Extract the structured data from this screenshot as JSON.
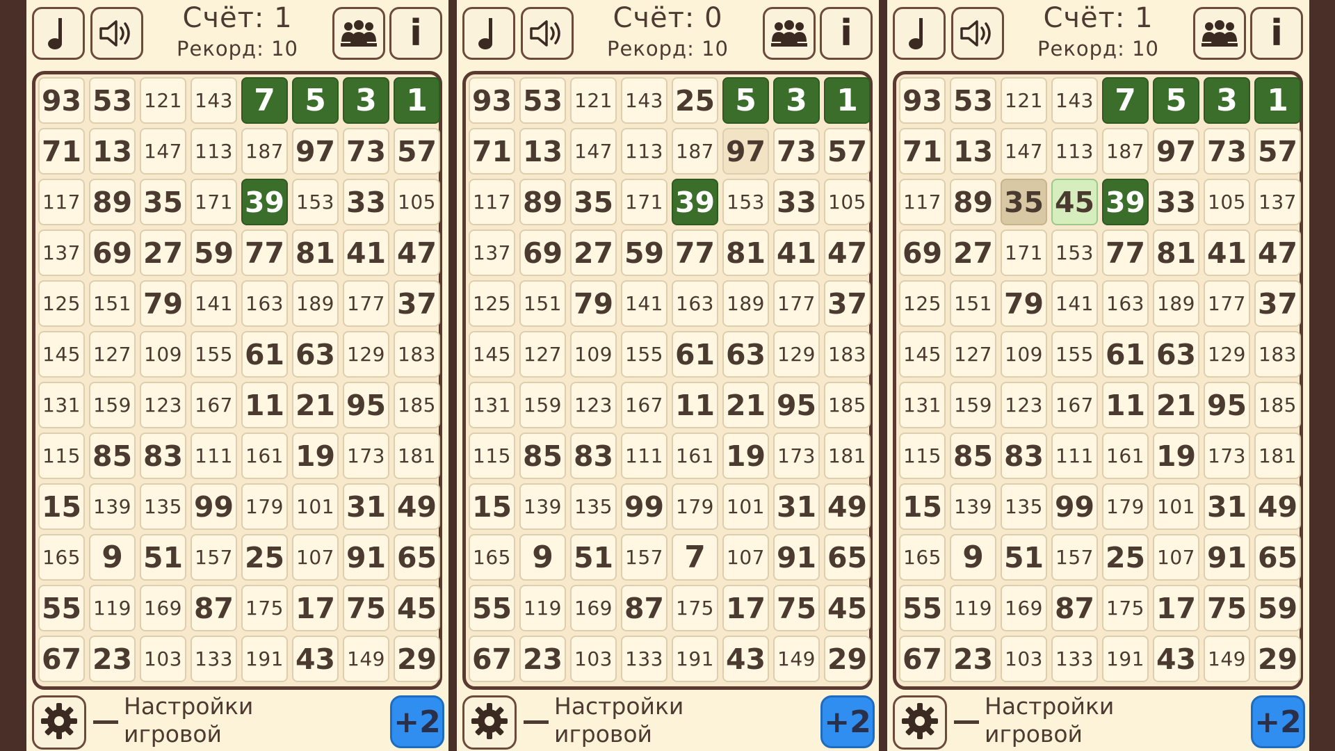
{
  "colors": {
    "background": "#4a2e28",
    "panel": "#fdf3d9",
    "cell": "#fff7e2",
    "cell_border": "#dccfae",
    "solved_green": "#3a6e2a",
    "highlight_light": "#d6edbe",
    "plus_button": "#2f8ef0",
    "text": "#4a3a30"
  },
  "icons": [
    "music-note-icon",
    "speaker-icon",
    "people-icon",
    "info-icon",
    "gear-icon"
  ],
  "labels": {
    "info_glyph": "i",
    "dash": "—",
    "settings_text": "Настройки игровой механики",
    "plus_label": "+2"
  },
  "screens": [
    {
      "score": "Счёт: 1",
      "record": "Рекорд: 10",
      "grid": [
        [
          "93",
          "53",
          "121",
          "143",
          "7",
          "5",
          "3",
          "1"
        ],
        [
          "71",
          "13",
          "147",
          "113",
          "187",
          "97",
          "73",
          "57"
        ],
        [
          "117",
          "89",
          "35",
          "171",
          "39",
          "153",
          "33",
          "105"
        ],
        [
          "137",
          "69",
          "27",
          "59",
          "77",
          "81",
          "41",
          "47"
        ],
        [
          "125",
          "151",
          "79",
          "141",
          "163",
          "189",
          "177",
          "37"
        ],
        [
          "145",
          "127",
          "109",
          "155",
          "61",
          "63",
          "129",
          "183"
        ],
        [
          "131",
          "159",
          "123",
          "167",
          "11",
          "21",
          "95",
          "185"
        ],
        [
          "115",
          "85",
          "83",
          "111",
          "161",
          "19",
          "173",
          "181"
        ],
        [
          "15",
          "139",
          "135",
          "99",
          "179",
          "101",
          "31",
          "49"
        ],
        [
          "165",
          "9",
          "51",
          "157",
          "25",
          "107",
          "91",
          "65"
        ],
        [
          "55",
          "119",
          "169",
          "87",
          "175",
          "17",
          "75",
          "45"
        ],
        [
          "67",
          "23",
          "103",
          "133",
          "191",
          "43",
          "149",
          "29"
        ]
      ],
      "states": [
        [
          "",
          "",
          "",
          "",
          "green",
          "green",
          "green",
          "green"
        ],
        [
          "",
          "",
          "",
          "",
          "",
          "",
          "",
          ""
        ],
        [
          "",
          "",
          "",
          "",
          "green",
          "",
          "",
          ""
        ],
        [
          "",
          "",
          "",
          "",
          "",
          "",
          "",
          ""
        ],
        [
          "",
          "",
          "",
          "",
          "",
          "",
          "",
          ""
        ],
        [
          "",
          "",
          "",
          "",
          "",
          "",
          "",
          ""
        ],
        [
          "",
          "",
          "",
          "",
          "",
          "",
          "",
          ""
        ],
        [
          "",
          "",
          "",
          "",
          "",
          "",
          "",
          ""
        ],
        [
          "",
          "",
          "",
          "",
          "",
          "",
          "",
          ""
        ],
        [
          "",
          "",
          "",
          "",
          "",
          "",
          "",
          ""
        ],
        [
          "",
          "",
          "",
          "",
          "",
          "",
          "",
          ""
        ],
        [
          "",
          "",
          "",
          "",
          "",
          "",
          "",
          ""
        ]
      ]
    },
    {
      "score": "Счёт: 0",
      "record": "Рекорд: 10",
      "grid": [
        [
          "93",
          "53",
          "121",
          "143",
          "25",
          "5",
          "3",
          "1"
        ],
        [
          "71",
          "13",
          "147",
          "113",
          "187",
          "97",
          "73",
          "57"
        ],
        [
          "117",
          "89",
          "35",
          "171",
          "39",
          "153",
          "33",
          "105"
        ],
        [
          "137",
          "69",
          "27",
          "59",
          "77",
          "81",
          "41",
          "47"
        ],
        [
          "125",
          "151",
          "79",
          "141",
          "163",
          "189",
          "177",
          "37"
        ],
        [
          "145",
          "127",
          "109",
          "155",
          "61",
          "63",
          "129",
          "183"
        ],
        [
          "131",
          "159",
          "123",
          "167",
          "11",
          "21",
          "95",
          "185"
        ],
        [
          "115",
          "85",
          "83",
          "111",
          "161",
          "19",
          "173",
          "181"
        ],
        [
          "15",
          "139",
          "135",
          "99",
          "179",
          "101",
          "31",
          "49"
        ],
        [
          "165",
          "9",
          "51",
          "157",
          "7",
          "107",
          "91",
          "65"
        ],
        [
          "55",
          "119",
          "169",
          "87",
          "175",
          "17",
          "75",
          "45"
        ],
        [
          "67",
          "23",
          "103",
          "133",
          "191",
          "43",
          "149",
          "29"
        ]
      ],
      "states": [
        [
          "",
          "",
          "",
          "",
          "",
          "green",
          "green",
          "green"
        ],
        [
          "",
          "",
          "",
          "",
          "",
          "sel",
          "",
          ""
        ],
        [
          "",
          "",
          "",
          "",
          "green",
          "",
          "",
          ""
        ],
        [
          "",
          "",
          "",
          "",
          "",
          "",
          "",
          ""
        ],
        [
          "",
          "",
          "",
          "",
          "",
          "",
          "",
          ""
        ],
        [
          "",
          "",
          "",
          "",
          "",
          "",
          "",
          ""
        ],
        [
          "",
          "",
          "",
          "",
          "",
          "",
          "",
          ""
        ],
        [
          "",
          "",
          "",
          "",
          "",
          "",
          "",
          ""
        ],
        [
          "",
          "",
          "",
          "",
          "",
          "",
          "",
          ""
        ],
        [
          "",
          "",
          "",
          "",
          "",
          "",
          "",
          ""
        ],
        [
          "",
          "",
          "",
          "",
          "",
          "",
          "",
          ""
        ],
        [
          "",
          "",
          "",
          "",
          "",
          "",
          "",
          ""
        ]
      ]
    },
    {
      "score": "Счёт: 1",
      "record": "Рекорд: 10",
      "grid": [
        [
          "93",
          "53",
          "121",
          "143",
          "7",
          "5",
          "3",
          "1"
        ],
        [
          "71",
          "13",
          "147",
          "113",
          "187",
          "97",
          "73",
          "57"
        ],
        [
          "117",
          "89",
          "35",
          "45",
          "39",
          "33",
          "105",
          "137"
        ],
        [
          "69",
          "27",
          "171",
          "153",
          "77",
          "81",
          "41",
          "47"
        ],
        [
          "125",
          "151",
          "79",
          "141",
          "163",
          "189",
          "177",
          "37"
        ],
        [
          "145",
          "127",
          "109",
          "155",
          "61",
          "63",
          "129",
          "183"
        ],
        [
          "131",
          "159",
          "123",
          "167",
          "11",
          "21",
          "95",
          "185"
        ],
        [
          "115",
          "85",
          "83",
          "111",
          "161",
          "19",
          "173",
          "181"
        ],
        [
          "15",
          "139",
          "135",
          "99",
          "179",
          "101",
          "31",
          "49"
        ],
        [
          "165",
          "9",
          "51",
          "157",
          "25",
          "107",
          "91",
          "65"
        ],
        [
          "55",
          "119",
          "169",
          "87",
          "175",
          "17",
          "75",
          "59"
        ],
        [
          "67",
          "23",
          "103",
          "133",
          "191",
          "43",
          "149",
          "29"
        ]
      ],
      "states": [
        [
          "",
          "",
          "",
          "",
          "green",
          "green",
          "green",
          "green"
        ],
        [
          "",
          "",
          "",
          "",
          "",
          "",
          "",
          ""
        ],
        [
          "",
          "",
          "pick",
          "light",
          "green",
          "",
          "",
          ""
        ],
        [
          "",
          "",
          "",
          "",
          "",
          "",
          "",
          ""
        ],
        [
          "",
          "",
          "",
          "",
          "",
          "",
          "",
          ""
        ],
        [
          "",
          "",
          "",
          "",
          "",
          "",
          "",
          ""
        ],
        [
          "",
          "",
          "",
          "",
          "",
          "",
          "",
          ""
        ],
        [
          "",
          "",
          "",
          "",
          "",
          "",
          "",
          ""
        ],
        [
          "",
          "",
          "",
          "",
          "",
          "",
          "",
          ""
        ],
        [
          "",
          "",
          "",
          "",
          "",
          "",
          "",
          ""
        ],
        [
          "",
          "",
          "",
          "",
          "",
          "",
          "",
          ""
        ],
        [
          "",
          "",
          "",
          "",
          "",
          "",
          "",
          ""
        ]
      ]
    }
  ]
}
